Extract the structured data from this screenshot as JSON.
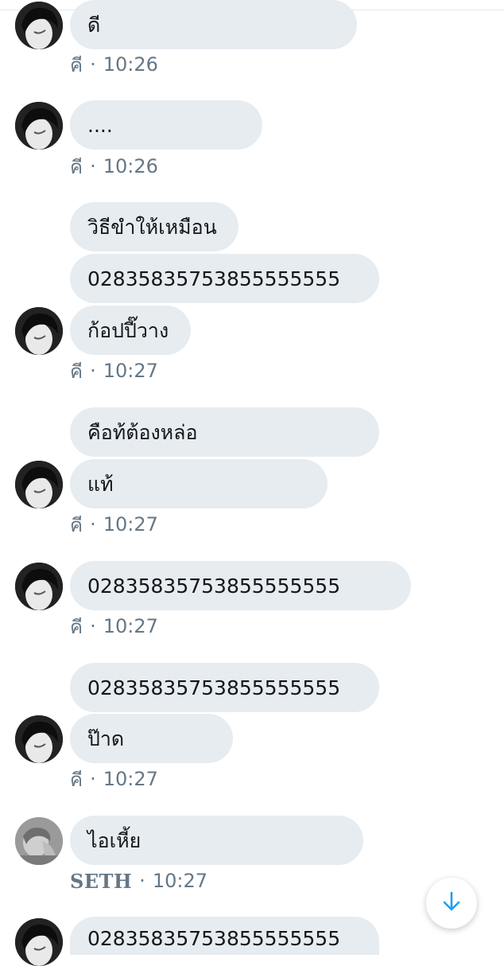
{
  "messages": [
    {
      "text": "ดี"
    },
    {
      "text": "...."
    },
    {
      "text": "วิธีขำให้เหมือน"
    },
    {
      "text": "02835835753855555555"
    },
    {
      "text": "ก้อปปี๊วาง"
    },
    {
      "text": "คือท้ต้องหล่อ"
    },
    {
      "text": "แท้"
    },
    {
      "text": "02835835753855555555"
    },
    {
      "text": "02835835753855555555"
    },
    {
      "text": "ป๊าด"
    },
    {
      "text": "ไอเหี้ย"
    },
    {
      "text": "02835835753855555555"
    }
  ],
  "meta": [
    {
      "name": "คี",
      "dot": "·",
      "time": "10:26"
    },
    {
      "name": "คี",
      "dot": "·",
      "time": "10:26"
    },
    {
      "name": "คี",
      "dot": "·",
      "time": "10:27"
    },
    {
      "name": "คี",
      "dot": "·",
      "time": "10:27"
    },
    {
      "name": "คี",
      "dot": "·",
      "time": "10:27"
    },
    {
      "name": "คี",
      "dot": "·",
      "time": "10:27"
    },
    {
      "name": "SETH",
      "dot": "·",
      "time": "10:27"
    }
  ],
  "icons": {
    "scroll_down": "arrow-down-icon",
    "accent": "#1da1f2"
  }
}
